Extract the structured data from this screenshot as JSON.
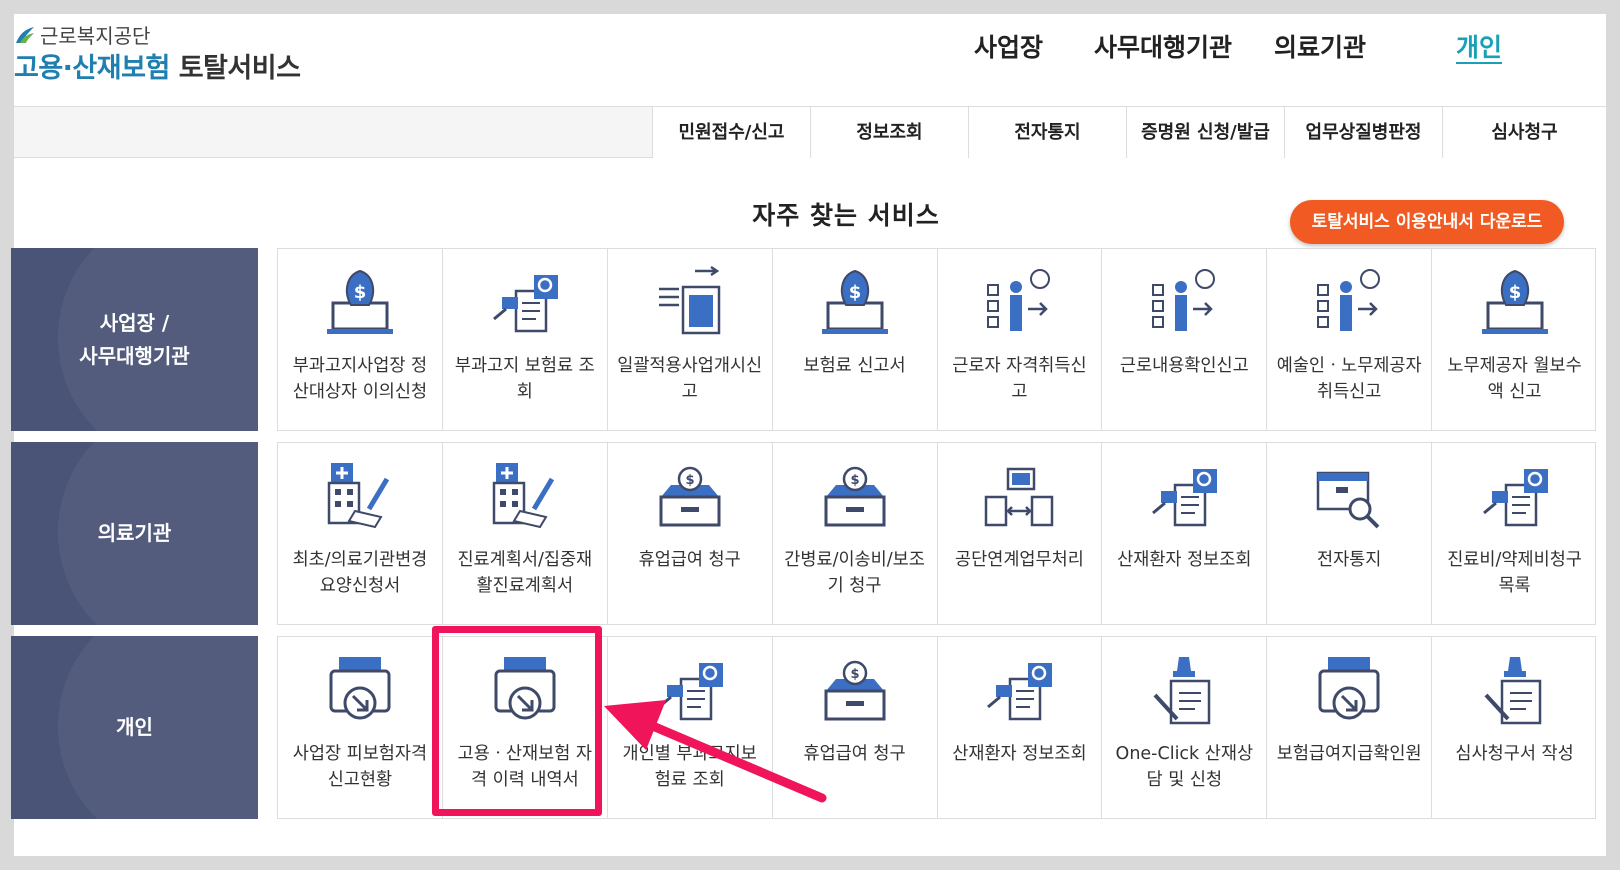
{
  "logo": {
    "org": "근로복지공단",
    "main_blue": "고용·산재보험",
    "main_dark": "토탈서비스"
  },
  "topnav": [
    {
      "label": "사업장",
      "active": false
    },
    {
      "label": "사무대행기관",
      "active": false
    },
    {
      "label": "의료기관",
      "active": false
    },
    {
      "label": "개인",
      "active": true
    }
  ],
  "subnav": [
    "민원접수/신고",
    "정보조회",
    "전자통지",
    "증명원 신청/발급",
    "업무상질병판정",
    "심사청구"
  ],
  "section_title": "자주 찾는 서비스",
  "download_button": "토탈서비스 이용안내서 다운로드",
  "rows": [
    {
      "label_line1": "사업장 /",
      "label_line2": "사무대행기관",
      "cards": [
        {
          "icon": "money-bag-laptop-icon",
          "label": "부과고지사업장 정산대상자 이의신청"
        },
        {
          "icon": "document-search-icon",
          "label": "부과고지 보험료 조회"
        },
        {
          "icon": "document-transfer-icon",
          "label": "일괄적용사업개시신고"
        },
        {
          "icon": "money-bag-laptop-icon",
          "label": "보험료 신고서"
        },
        {
          "icon": "worker-checklist-icon",
          "label": "근로자 자격취득신고"
        },
        {
          "icon": "worker-checklist-icon",
          "label": "근로내용확인신고"
        },
        {
          "icon": "worker-checklist-icon",
          "label": "예술인ㆍ노무제공자 취득신고"
        },
        {
          "icon": "money-bag-laptop-icon",
          "label": "노무제공자 월보수액 신고"
        }
      ]
    },
    {
      "label_line1": "의료기관",
      "label_line2": "",
      "cards": [
        {
          "icon": "hospital-pen-icon",
          "label": "최초/의료기관변경요양신청서"
        },
        {
          "icon": "hospital-pen-icon",
          "label": "진료계획서/집중재활진료계획서"
        },
        {
          "icon": "coin-box-icon",
          "label": "휴업급여 청구"
        },
        {
          "icon": "coin-box-icon",
          "label": "간병료/이송비/보조기 청구"
        },
        {
          "icon": "document-exchange-icon",
          "label": "공단연계업무처리"
        },
        {
          "icon": "document-search-icon",
          "label": "산재환자 정보조회"
        },
        {
          "icon": "box-magnifier-icon",
          "label": "전자통지"
        },
        {
          "icon": "document-search-icon",
          "label": "진료비/약제비청구목록"
        }
      ]
    },
    {
      "label_line1": "개인",
      "label_line2": "",
      "cards": [
        {
          "icon": "printer-arrow-icon",
          "label": "사업장 피보험자격 신고현황"
        },
        {
          "icon": "printer-arrow-icon",
          "label": "고용ㆍ산재보험 자격 이력 내역서"
        },
        {
          "icon": "document-search-icon",
          "label": "개인별 부과고지보험료 조회"
        },
        {
          "icon": "coin-box-icon",
          "label": "휴업급여 청구"
        },
        {
          "icon": "document-search-icon",
          "label": "산재환자 정보조회"
        },
        {
          "icon": "stamp-document-icon",
          "label": "One-Click 산재상담 및 신청"
        },
        {
          "icon": "printer-arrow-icon",
          "label": "보험급여지급확인원"
        },
        {
          "icon": "stamp-document-icon",
          "label": "심사청구서 작성"
        }
      ]
    }
  ],
  "colors": {
    "row_label_bg": "#4a5477",
    "icon_blue": "#3b6fc4",
    "icon_navy": "#3f4a6b",
    "accent_orange": "#f15a22",
    "highlight_pink": "#f0145a",
    "logo_blue": "#1f7fb0",
    "active_teal": "#1aa0b6"
  }
}
